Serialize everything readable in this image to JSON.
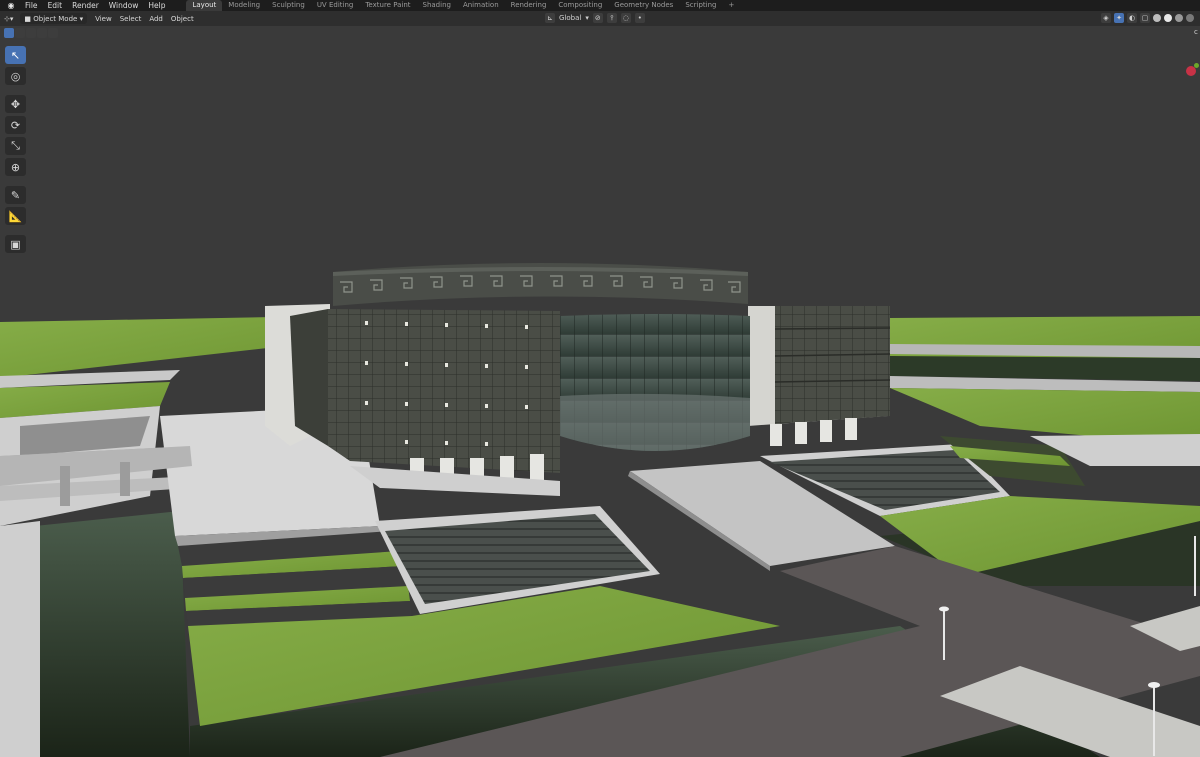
{
  "menu": [
    "File",
    "Edit",
    "Render",
    "Window",
    "Help"
  ],
  "workspaces": [
    {
      "label": "Layout",
      "active": true
    },
    {
      "label": "Modeling",
      "active": false
    },
    {
      "label": "Sculpting",
      "active": false
    },
    {
      "label": "UV Editing",
      "active": false
    },
    {
      "label": "Texture Paint",
      "active": false
    },
    {
      "label": "Shading",
      "active": false
    },
    {
      "label": "Animation",
      "active": false
    },
    {
      "label": "Rendering",
      "active": false
    },
    {
      "label": "Compositing",
      "active": false
    },
    {
      "label": "Geometry Nodes",
      "active": false
    },
    {
      "label": "Scripting",
      "active": false
    }
  ],
  "workspace_add": "+",
  "viewport": {
    "mode": "Object Mode",
    "menu": [
      "View",
      "Select",
      "Add",
      "Object"
    ],
    "orientation": "Global"
  },
  "icons": {
    "logo": "blender-logo-icon",
    "editor_type": "viewport-editor-icon",
    "object_mode": "object-mode-icon",
    "orientation": "transform-orientation-icon",
    "pivot": "pivot-point-icon",
    "snap": "snap-icon",
    "proportional": "proportional-edit-icon",
    "visibility": "visibility-icon",
    "gizmos": "gizmos-icon",
    "overlays": "overlays-icon",
    "xray": "xray-icon"
  },
  "tools": [
    {
      "name": "select-box",
      "glyph": "↖",
      "active": true
    },
    {
      "name": "cursor",
      "glyph": "◎",
      "active": false
    },
    {
      "name": "move",
      "glyph": "✥",
      "active": false
    },
    {
      "name": "rotate",
      "glyph": "⟳",
      "active": false
    },
    {
      "name": "scale",
      "glyph": "⤡",
      "active": false
    },
    {
      "name": "transform",
      "glyph": "⊕",
      "active": false
    },
    {
      "name": "annotate",
      "glyph": "✎",
      "active": false
    },
    {
      "name": "measure",
      "glyph": "📐",
      "active": false
    },
    {
      "name": "add-cube",
      "glyph": "▣",
      "active": false
    }
  ],
  "colors": {
    "accent": "#4772b3",
    "sky": "#3a3a3a",
    "grass": "#7aa33a",
    "water": "#1e2a1e",
    "road": "#5b5656",
    "plaza": "#d8d8d8",
    "facade": "#4b4d45",
    "glass": "#3e4a44"
  }
}
